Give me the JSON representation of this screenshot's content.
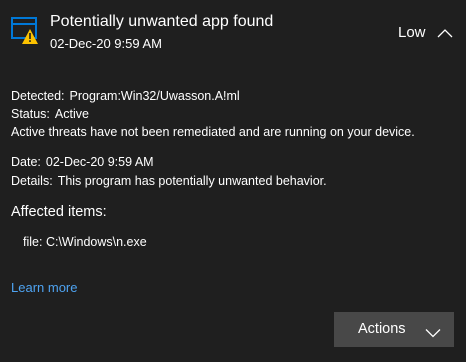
{
  "header": {
    "title": "Potentially unwanted app found",
    "timestamp": "02-Dec-20 9:59 AM",
    "severity": "Low",
    "icon": "warning-window-icon",
    "collapse_icon": "chevron-up-icon"
  },
  "details": {
    "detected_label": "Detected:",
    "detected_value": "Program:Win32/Uwasson.A!ml",
    "status_label": "Status:",
    "status_value": "Active",
    "status_note": "Active threats have not been remediated and are running on your device.",
    "date_label": "Date:",
    "date_value": "02-Dec-20 9:59 AM",
    "details_label": "Details:",
    "details_value": "This program has potentially unwanted behavior."
  },
  "affected": {
    "heading": "Affected items:",
    "items": [
      {
        "prefix": "file:",
        "path": "C:\\Windows\\n.exe"
      }
    ]
  },
  "links": {
    "learn_more": "Learn more"
  },
  "actions": {
    "label": "Actions",
    "icon": "chevron-down-icon"
  },
  "colors": {
    "background": "#1f1f1f",
    "link": "#4ea3f1",
    "button": "#484848",
    "icon_blue": "#0078d7",
    "warning_yellow": "#fcc200"
  }
}
